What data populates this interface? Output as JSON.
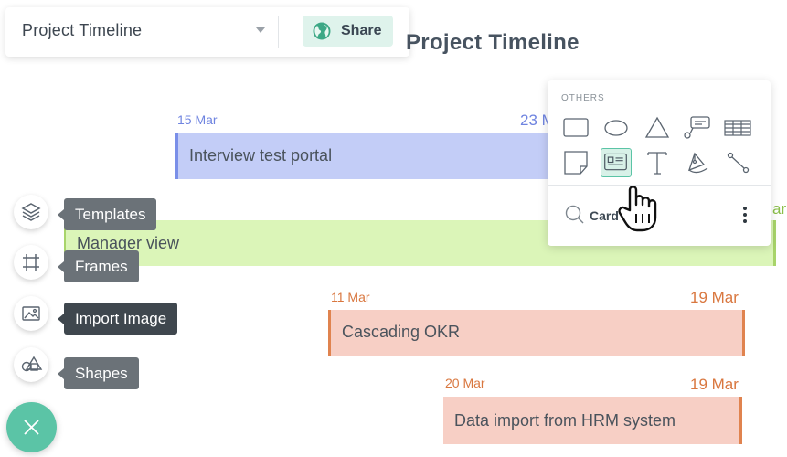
{
  "project": {
    "name": "Project Timeline",
    "share_label": "Share"
  },
  "page_title": "Project Timeline",
  "timeline": [
    {
      "start": "15 Mar",
      "end": "23 M",
      "label": "Interview test portal",
      "fill": "#c3cdf7",
      "border": "#7a8fe8",
      "date_color": "#6f84e0"
    },
    {
      "start": "",
      "end": "ar",
      "label": "Manager view",
      "fill": "#dbf5b8",
      "border": "#a8d46a",
      "date_color": "#8bbf4a"
    },
    {
      "start": "11 Mar",
      "end": "19 Mar",
      "label": "Cascading OKR",
      "fill": "#f7cfc5",
      "border": "#e0834f",
      "date_color": "#d9773f"
    },
    {
      "start": "20 Mar",
      "end": "19 Mar",
      "label": "Data import from HRM system",
      "fill": "#f7cfc5",
      "border": "#e0834f",
      "date_color": "#d9773f"
    }
  ],
  "toolbar": [
    {
      "label": "Templates",
      "icon": "layers-icon"
    },
    {
      "label": "Frames",
      "icon": "frame-icon"
    },
    {
      "label": "Import Image",
      "icon": "image-icon"
    },
    {
      "label": "Shapes",
      "icon": "shapes-icon"
    }
  ],
  "fab_icon": "close-icon",
  "shape_panel": {
    "section_title": "OTHERS",
    "search_value": "Card",
    "shapes": [
      "rectangle-icon",
      "ellipse-icon",
      "triangle-icon",
      "callout-icon",
      "table-icon",
      "note-icon",
      "card-icon",
      "text-icon",
      "pen-icon",
      "connector-icon"
    ],
    "selected": "card-icon"
  },
  "colors": {
    "accent": "#5bc4a6",
    "tooltip": "#6b7278",
    "tooltip_active": "#3f474e"
  }
}
